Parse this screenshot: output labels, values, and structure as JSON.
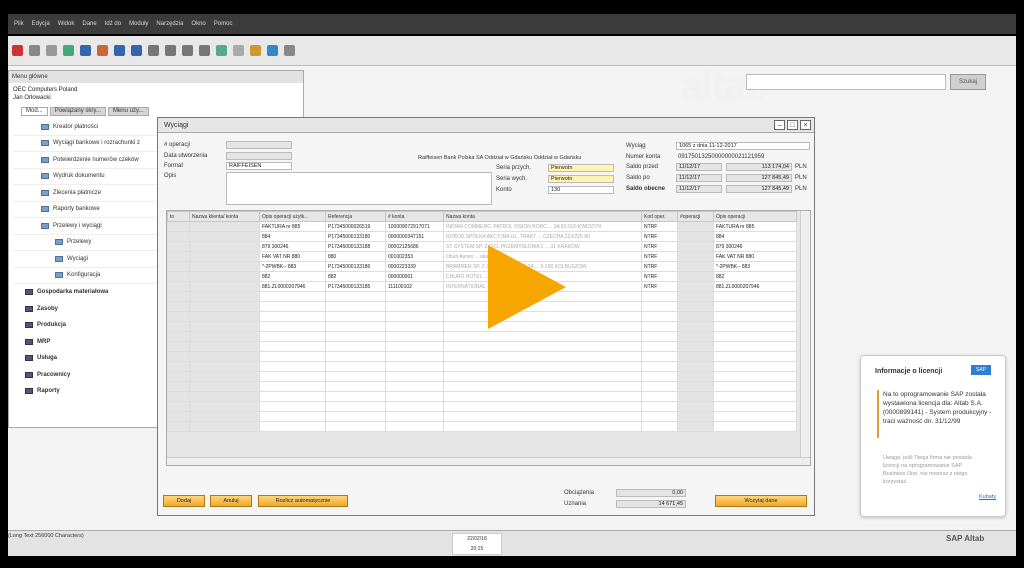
{
  "menubar": [
    "Plik",
    "Edycja",
    "Widok",
    "Dane",
    "Idź do",
    "Moduły",
    "Narzędzia",
    "Okno",
    "Pomoc"
  ],
  "search": {
    "button": "Szukaj"
  },
  "watermark": "altab",
  "colors": {
    "accent": "#f7a600",
    "title_bar": "#e6e6e6",
    "menubar": "#3c3c3c"
  },
  "main_menu": {
    "title": "Menu główne",
    "company": "OEC Computers Poland",
    "user": "Jan Orłowacki",
    "tabs": [
      "Mod...",
      "Powiązany skry...",
      "Menu uży..."
    ],
    "items": [
      {
        "label": "Kreator płatności",
        "level": "item"
      },
      {
        "label": "Wyciągi bankowe i rozrachunki z",
        "level": "item"
      },
      {
        "label": "Potwierdzenie numerów czeków",
        "level": "item"
      },
      {
        "label": "Wydruk dokumentu",
        "level": "item"
      },
      {
        "label": "Zlecenia płatnicze",
        "level": "item"
      },
      {
        "label": "Raporty bankowe",
        "level": "item"
      },
      {
        "label": "Przelewy i wyciągi",
        "level": "item"
      },
      {
        "label": "Przelewy",
        "level": "sub"
      },
      {
        "label": "Wyciągi",
        "level": "sub"
      },
      {
        "label": "Konfiguracja",
        "level": "sub"
      },
      {
        "label": "Gospodarka materiałowa",
        "level": "mod"
      },
      {
        "label": "Zasoby",
        "level": "mod"
      },
      {
        "label": "Produkcja",
        "level": "mod"
      },
      {
        "label": "MRP",
        "level": "mod"
      },
      {
        "label": "Usługa",
        "level": "mod"
      },
      {
        "label": "Pracownicy",
        "level": "mod"
      },
      {
        "label": "Raporty",
        "level": "mod"
      }
    ]
  },
  "dialog": {
    "title": "Wyciągi",
    "labels": {
      "op_no": "# operacji",
      "created": "Data utworzenia",
      "format": "Format",
      "desc": "Opis",
      "series_in": "Seria przych.",
      "series_out": "Seria wych.",
      "account": "Konto",
      "statement": "Wyciąg",
      "account_no": "Numer konta",
      "balance_before": "Saldo przed",
      "balance_after": "Saldo po",
      "balance_now": "Saldo obecne"
    },
    "format_value": "RAIFFEISEN",
    "bank": "Raiffeisen Bank Polska SA Oddział w Gdańsku Oddział w Gdańsku",
    "series_in_value": "Pierwotn",
    "series_out_value": "Pierwotn",
    "account_value": "130",
    "statement_value": "1065 z dnia 11-12-2017",
    "account_no_value": "09175013250000000021121959",
    "balance_before_date": "11/12/17",
    "balance_before_value": "113 174,04",
    "balance_after_date": "11/12/17",
    "balance_after_value": "127 845,49",
    "balance_now_date": "11/12/17",
    "balance_now_value": "127 845,49",
    "currency": "PLN",
    "columns": [
      "to",
      "Nazwa klienta/ konta",
      "Opis operacji użytk...",
      "Referencja",
      "# konta",
      "Nazwa konta",
      "Kod oper.",
      "#operacji",
      "Opis operacji"
    ],
    "rows": [
      [
        "",
        "",
        "FAKTURA nr 885",
        "P17345000026519",
        "100009072917071",
        "INDIAN COMMERC. PATROL VISION BORC ... 3A 82-500 KWIDZYN",
        "NTRF",
        "",
        "FAKTURA nr 885"
      ],
      [
        "",
        "",
        "884",
        "P17345000133180",
        "0000000347151",
        "ROBOD SPÓŁKA AKCYJNA UL. TRAKT ... CZECHA 223/225 80",
        "NTRF",
        "",
        "884"
      ],
      [
        "",
        "",
        "879 300246",
        "P17345000133188",
        "00002125686",
        "ST SYSTEM SP. Z O.O. PRZEMYSŁOWA 1 ... 31 KRAKÓW",
        "NTRF",
        "",
        "879 300246"
      ],
      [
        "",
        "",
        "FAK VAT NR 880",
        "880",
        "001002353",
        "Obuh Asnes ... ukawa 1",
        "NTRF",
        "",
        "FAK VAT NR 880"
      ],
      [
        "",
        "",
        "*-2PWBK-- 883",
        "P17345000133186",
        "0000223339",
        "BRAMMER SP. Z O.O. KANDLOWA 2A ... 6-100 KOLBUSZOW",
        "NTRF",
        "",
        "*-2PWBK-- 883"
      ],
      [
        "",
        "",
        "882",
        "882",
        "000000001",
        "CHURO HOTEL ... INNOWACYJNA 4",
        "NTRF",
        "",
        "882"
      ],
      [
        "",
        "",
        "881.ZL0000207946",
        "P17345000133185",
        "111100102",
        "INTERNATIONAL ... TORÓW NR 8 39",
        "NTRF",
        "",
        "881.ZL0000207946"
      ]
    ],
    "summary": {
      "outflow_label": "Obciążenia",
      "outflow_value": "0,00",
      "inflow_label": "Uznania",
      "inflow_value": "14 671,45"
    },
    "buttons": {
      "add": "Dodaj",
      "cancel": "Anuluj",
      "auto": "Rozlicz automatycznie",
      "load": "Wczytaj dane"
    }
  },
  "license": {
    "title": "Informacje o licencji",
    "logo": "SAP",
    "message": "Na to oprogramowanie SAP została wystawiona licencja dla: Altab S.A. (0000899141) - System produkcyjny - traci ważność dn. 31/12/99",
    "note": "Uwaga, jeśli Twoja firma nie posiada licencji na oprogramowanie SAP Business One, nie możesz z niego korzystać.",
    "link": "Kubaty"
  },
  "statusbar": {
    "text": "(Long Text 256000 Characters)",
    "date": "22/02/18",
    "time": "20:15"
  },
  "brand": "SAP Altab"
}
